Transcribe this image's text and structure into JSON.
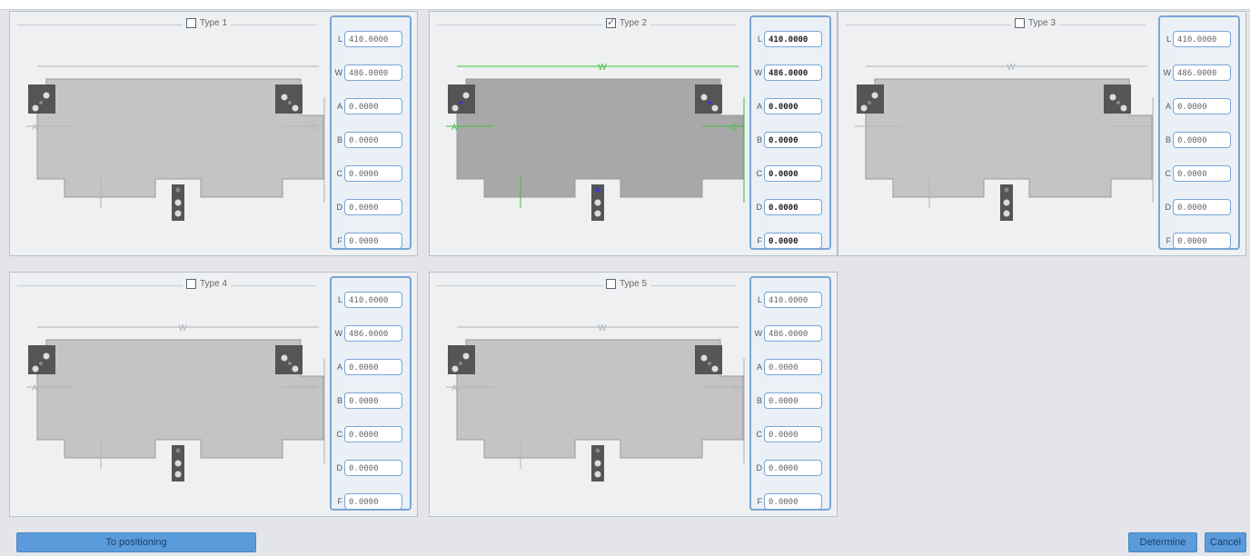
{
  "panels": [
    {
      "type_label": "Type 1",
      "checked": false,
      "fields": [
        {
          "label": "L",
          "value": "410.0000"
        },
        {
          "label": "W",
          "value": "486.0000"
        },
        {
          "label": "A",
          "value": "0.0000"
        },
        {
          "label": "B",
          "value": "0.0000"
        },
        {
          "label": "C",
          "value": "0.0000"
        },
        {
          "label": "D",
          "value": "0.0000"
        },
        {
          "label": "F",
          "value": "0.0000"
        }
      ],
      "dims": {
        "w": "",
        "a": "A",
        "c": "C"
      }
    },
    {
      "type_label": "Type 2",
      "checked": true,
      "fields": [
        {
          "label": "L",
          "value": "410.0000"
        },
        {
          "label": "W",
          "value": "486.0000"
        },
        {
          "label": "A",
          "value": "0.0000"
        },
        {
          "label": "B",
          "value": "0.0000"
        },
        {
          "label": "C",
          "value": "0.0000"
        },
        {
          "label": "D",
          "value": "0.0000"
        },
        {
          "label": "F",
          "value": "0.0000"
        }
      ],
      "dims": {
        "w": "W",
        "a": "A",
        "c": "C"
      }
    },
    {
      "type_label": "Type 3",
      "checked": false,
      "fields": [
        {
          "label": "L",
          "value": "410.0000"
        },
        {
          "label": "W",
          "value": "486.0000"
        },
        {
          "label": "A",
          "value": "0.0000"
        },
        {
          "label": "B",
          "value": "0.0000"
        },
        {
          "label": "C",
          "value": "0.0000"
        },
        {
          "label": "D",
          "value": "0.0000"
        },
        {
          "label": "F",
          "value": "0.0000"
        }
      ],
      "dims": {
        "w": "W",
        "a": "",
        "c": ""
      }
    },
    {
      "type_label": "Type 4",
      "checked": false,
      "fields": [
        {
          "label": "L",
          "value": "410.0000"
        },
        {
          "label": "W",
          "value": "486.0000"
        },
        {
          "label": "A",
          "value": "0.0000"
        },
        {
          "label": "B",
          "value": "0.0000"
        },
        {
          "label": "C",
          "value": "0.0000"
        },
        {
          "label": "D",
          "value": "0.0000"
        },
        {
          "label": "F",
          "value": "0.0000"
        }
      ],
      "dims": {
        "w": "W",
        "a": "A",
        "c": "C"
      }
    },
    {
      "type_label": "Type 5",
      "checked": false,
      "fields": [
        {
          "label": "L",
          "value": "410.0000"
        },
        {
          "label": "W",
          "value": "486.0000"
        },
        {
          "label": "A",
          "value": "0.0000"
        },
        {
          "label": "B",
          "value": "0.0000"
        },
        {
          "label": "C",
          "value": "0.0000"
        },
        {
          "label": "D",
          "value": "0.0000"
        },
        {
          "label": "F",
          "value": "0.0000"
        }
      ],
      "dims": {
        "w": "W",
        "a": "A",
        "c": "C"
      }
    }
  ],
  "buttons": {
    "positioning": "To positioning",
    "determine": "Determine",
    "cancel": "Cancel"
  },
  "colors": {
    "accent": "#5b9bdb",
    "field_border": "#7aa6d6",
    "dimension_green": "#3cc43c",
    "marker_blue": "#3a3ad0"
  }
}
